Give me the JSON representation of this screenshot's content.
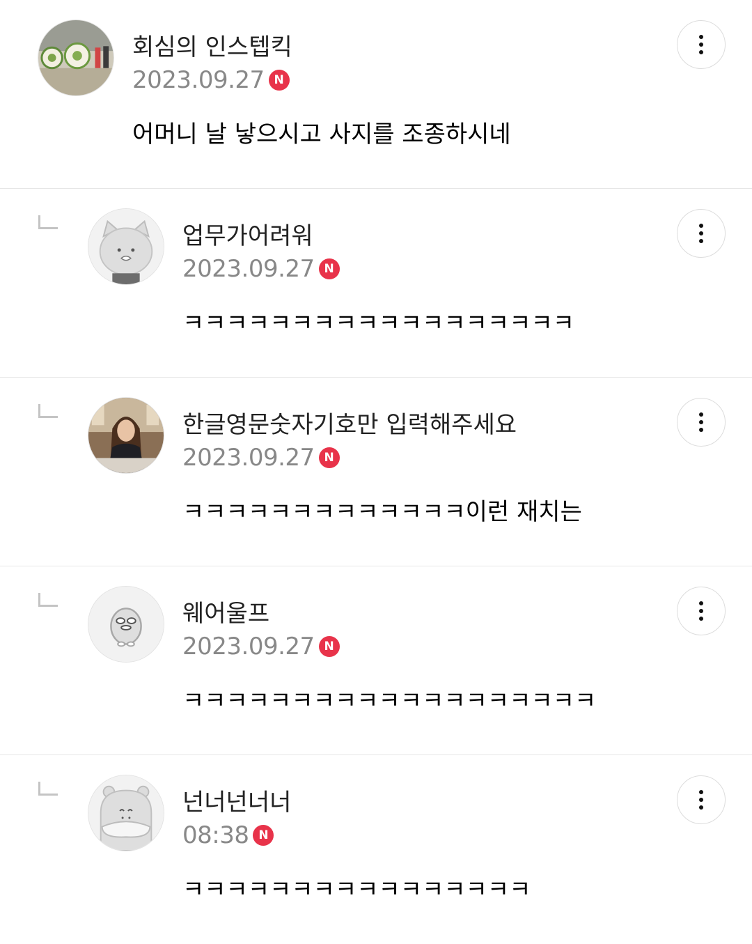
{
  "comments": [
    {
      "author": "회심의 인스텝킥",
      "date": "2023.09.27",
      "badge": "N",
      "text": "어머니 날 낳으시고 사지를 조종하시네",
      "avatar": "photo-dartboards"
    },
    {
      "author": "업무가어려워",
      "date": "2023.09.27",
      "badge": "N",
      "text": "ㅋㅋㅋㅋㅋㅋㅋㅋㅋㅋㅋㅋㅋㅋㅋㅋㅋㅋ",
      "avatar": "default-cat"
    },
    {
      "author": "한글영문숫자기호만 입력해주세요",
      "date": "2023.09.27",
      "badge": "N",
      "text": "ㅋㅋㅋㅋㅋㅋㅋㅋㅋㅋㅋㅋㅋ이런 재치는",
      "avatar": "photo-woman"
    },
    {
      "author": "웨어울프",
      "date": "2023.09.27",
      "badge": "N",
      "text": "ㅋㅋㅋㅋㅋㅋㅋㅋㅋㅋㅋㅋㅋㅋㅋㅋㅋㅋㅋ",
      "avatar": "default-duck"
    },
    {
      "author": "넌너넌너너",
      "date": "08:38",
      "badge": "N",
      "text": "ㅋㅋㅋㅋㅋㅋㅋㅋㅋㅋㅋㅋㅋㅋㅋㅋ",
      "avatar": "default-hamster"
    }
  ],
  "icons": {
    "reply": "reply-arrow-icon",
    "more": "more-vertical-icon",
    "badge_color": "#e8334a"
  }
}
